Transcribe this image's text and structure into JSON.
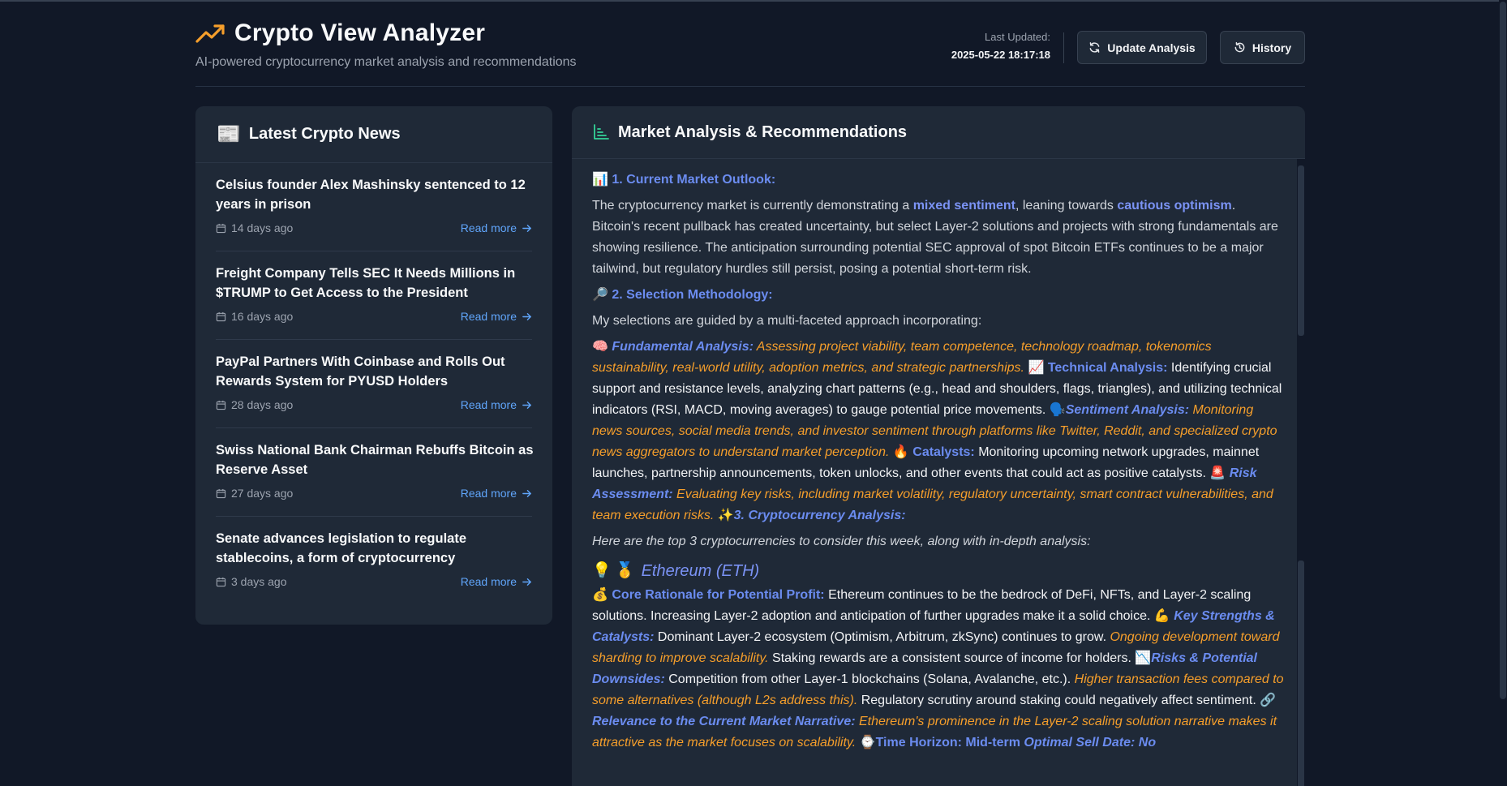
{
  "app": {
    "title": "Crypto View Analyzer",
    "subtitle": "AI-powered cryptocurrency market analysis and recommendations",
    "last_updated_label": "Last Updated:",
    "last_updated_value": "2025-05-22 18:17:18",
    "update_button": "Update Analysis",
    "history_button": "History",
    "accent_color": "#f59e2b"
  },
  "news": {
    "title": "Latest Crypto News",
    "read_more": "Read more",
    "items": [
      {
        "title": "Celsius founder Alex Mashinsky sentenced to 12 years in prison",
        "age": "14 days ago"
      },
      {
        "title": "Freight Company Tells SEC It Needs Millions in $TRUMP to Get Access to the President",
        "age": "16 days ago"
      },
      {
        "title": "PayPal Partners With Coinbase and Rolls Out Rewards System for PYUSD Holders",
        "age": "28 days ago"
      },
      {
        "title": "Swiss National Bank Chairman Rebuffs Bitcoin as Reserve Asset",
        "age": "27 days ago"
      },
      {
        "title": "Senate advances legislation to regulate stablecoins, a form of cryptocurrency",
        "age": "3 days ago"
      }
    ]
  },
  "analysis": {
    "title": "Market Analysis & Recommendations",
    "s1_icon": "📊",
    "s1_title": "1. Current Market Outlook:",
    "s1_p_a": "The cryptocurrency market is currently demonstrating a ",
    "s1_kw1": "mixed sentiment",
    "s1_p_b": ", leaning towards ",
    "s1_kw2": "cautious optimism",
    "s1_p_c": ". Bitcoin's recent pullback has created uncertainty, but select Layer-2 solutions and projects with strong fundamentals are showing resilience. The anticipation surrounding potential SEC approval of spot Bitcoin ETFs continues to be a major tailwind, but regulatory hurdles still persist, posing a potential short-term risk.",
    "s2_icon": "🔎",
    "s2_title": "2. Selection Methodology:",
    "s2_intro": "My selections are guided by a multi-faceted approach incorporating:",
    "fa_icon": "🧠",
    "fa_label": "Fundamental Analysis:",
    "fa_text": " Assessing project viability, team competence, technology roadmap, tokenomics sustainability, real-world utility, adoption metrics, and strategic partnerships.",
    "ta_icon": "📈",
    "ta_label": "Technical Analysis:",
    "ta_text": " Identifying crucial support and resistance levels, analyzing chart patterns (e.g., head and shoulders, flags, triangles), and utilizing technical indicators (RSI, MACD, moving averages) to gauge potential price movements.",
    "sa_icon": "🗣️",
    "sa_label": "Sentiment Analysis:",
    "sa_text": " Monitoring news sources, social media trends, and investor sentiment through platforms like Twitter, Reddit, and specialized crypto news aggregators to understand market perception.",
    "ca_icon": "🔥",
    "ca_label": "Catalysts:",
    "ca_text": " Monitoring upcoming network upgrades, mainnet launches, partnership announcements, token unlocks, and other events that could act as positive catalysts.",
    "ra_icon": "🚨",
    "ra_label": "Risk Assessment:",
    "ra_text": " Evaluating key risks, including market volatility, regulatory uncertainty, smart contract vulnerabilities, and team execution risks.",
    "s3_icon": "✨",
    "s3_title": "3. Cryptocurrency Analysis:",
    "s3_intro": "Here are the top 3 cryptocurrencies to consider this week, along with in-depth analysis:",
    "coin_icons": "💡 🥇",
    "coin_name": "Ethereum (ETH)",
    "cr_icon": "💰",
    "cr_label": "Core Rationale for Potential Profit:",
    "cr_text": " Ethereum continues to be the bedrock of DeFi, NFTs, and Layer-2 scaling solutions. Increasing Layer-2 adoption and anticipation of further upgrades make it a solid choice.",
    "ks_icon": "💪",
    "ks_label": "Key Strengths & Catalysts:",
    "ks_text": " Dominant Layer-2 ecosystem (Optimism, Arbitrum, zkSync) continues to grow.",
    "ks_o": " Ongoing development toward sharding to improve scalability.",
    "ks_text2": " Staking rewards are a consistent source of income for holders.",
    "rk_icon": "📉",
    "rk_label": "Risks & Potential Downsides:",
    "rk_text": " Competition from other Layer-1 blockchains (Solana, Avalanche, etc.).",
    "rk_o": " Higher transaction fees compared to some alternatives (although L2s address this).",
    "rk_text2": " Regulatory scrutiny around staking could negatively affect sentiment.",
    "rel_icon": "🔗",
    "rel_label": "Relevance to the Current Market Narrative:",
    "rel_text": " Ethereum's prominence in the Layer-2 scaling solution narrative makes it attractive as the market focuses on scalability.",
    "th_icon": "⌚",
    "th_label": "Time Horizon: Mid-term",
    "os_label": "Optimal Sell Date: No"
  }
}
